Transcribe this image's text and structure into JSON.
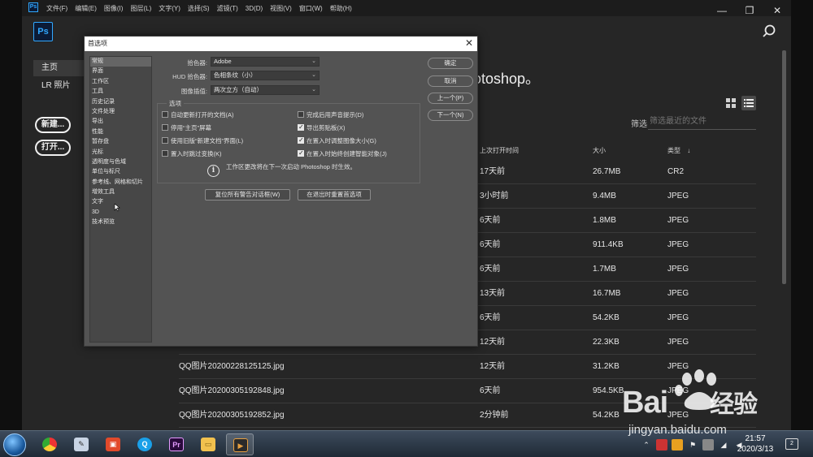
{
  "menubar": {
    "items": [
      "文件(F)",
      "编辑(E)",
      "图像(I)",
      "图层(L)",
      "文字(Y)",
      "选择(S)",
      "滤镜(T)",
      "3D(D)",
      "视图(V)",
      "窗口(W)",
      "帮助(H)"
    ],
    "window_controls": [
      "—",
      "❐",
      "✕"
    ]
  },
  "app": {
    "logo": "Ps",
    "small_logo": "Ps"
  },
  "home": {
    "nav": {
      "home": "主页",
      "lr": "LR 照片"
    },
    "new_button": "新建...",
    "open_button": "打开...",
    "welcome_fragment": "otoshop。",
    "filter_label": "筛选",
    "filter_placeholder": "筛选最近的文件",
    "columns": {
      "time": "上次打开时间",
      "size": "大小",
      "type": "类型"
    },
    "sort_indicator": "↓",
    "files": [
      {
        "name": "",
        "time": "17天前",
        "size": "26.7MB",
        "type": "CR2"
      },
      {
        "name": "",
        "time": "3小时前",
        "size": "9.4MB",
        "type": "JPEG"
      },
      {
        "name": "",
        "time": "6天前",
        "size": "1.8MB",
        "type": "JPEG"
      },
      {
        "name": "",
        "time": "6天前",
        "size": "911.4KB",
        "type": "JPEG"
      },
      {
        "name": "",
        "time": "6天前",
        "size": "1.7MB",
        "type": "JPEG"
      },
      {
        "name": "",
        "time": "13天前",
        "size": "16.7MB",
        "type": "JPEG"
      },
      {
        "name": "",
        "time": "6天前",
        "size": "54.2KB",
        "type": "JPEG"
      },
      {
        "name": "",
        "time": "12天前",
        "size": "22.3KB",
        "type": "JPEG"
      },
      {
        "name": "QQ图片20200228125125.jpg",
        "time": "12天前",
        "size": "31.2KB",
        "type": "JPEG"
      },
      {
        "name": "QQ图片20200305192848.jpg",
        "time": "6天前",
        "size": "954.5KB",
        "type": "JPEG"
      },
      {
        "name": "QQ图片20200305192852.jpg",
        "time": "2分钟前",
        "size": "54.2KB",
        "type": "JPEG"
      }
    ]
  },
  "dialog": {
    "title": "首选项",
    "close": "✕",
    "categories": [
      "常规",
      "界面",
      "工作区",
      "工具",
      "历史记录",
      "文件处理",
      "导出",
      "性能",
      "暂存盘",
      "光标",
      "透明度与色域",
      "单位与标尺",
      "参考线、网格和切片",
      "增效工具",
      "文字",
      "3D",
      "技术预览"
    ],
    "fields": {
      "color_picker_label": "拾色器:",
      "color_picker_value": "Adobe",
      "hud_label": "HUD 拾色器:",
      "hud_value": "色相条纹（小）",
      "interp_label": "图像插值:",
      "interp_value": "两次立方（自动）"
    },
    "options_legend": "选项",
    "options_left": [
      {
        "label": "自动更新打开的文档(A)",
        "checked": false
      },
      {
        "label": "停用“主页”屏幕",
        "checked": false
      },
      {
        "label": "使用旧版“新建文档”界面(L)",
        "checked": false
      },
      {
        "label": "置入时跳过变换(K)",
        "checked": false
      }
    ],
    "options_right": [
      {
        "label": "完成后用声音提示(D)",
        "checked": false
      },
      {
        "label": "导出剪贴板(X)",
        "checked": true
      },
      {
        "label": "在置入时调整图像大小(G)",
        "checked": true
      },
      {
        "label": "在置入时始终创建智能对象(J)",
        "checked": true
      }
    ],
    "info_text": "工作区更改将在下一次启动 Photoshop 时生效。",
    "buttons": {
      "ok": "确定",
      "cancel": "取消",
      "prev": "上一个(P)",
      "next": "下一个(N)",
      "reset_warnings": "复位所有警告对话框(W)",
      "reset_prefs": "在退出时重置首选项"
    }
  },
  "taskbar": {
    "clock_time": "21:57",
    "clock_date": "2020/3/13",
    "notify_count": "2"
  },
  "watermark": {
    "brand": "Bai",
    "brand_cn": "经验",
    "url": "jingyan.baidu.com"
  },
  "colors": {
    "ps_blue": "#31a8ff",
    "bg": "#262626",
    "dialog": "#535353"
  }
}
